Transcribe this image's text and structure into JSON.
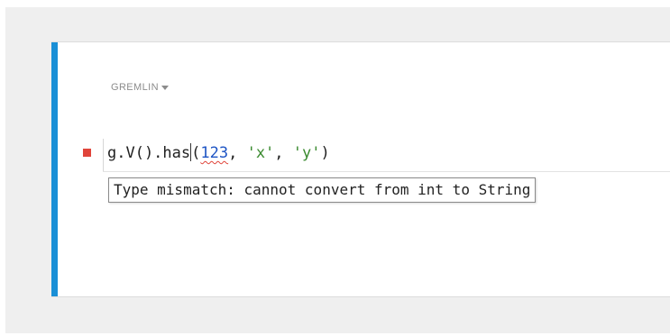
{
  "language_selector": {
    "label": "GREMLIN",
    "icon": "chevron-down-icon"
  },
  "editor": {
    "code_tokens": {
      "prefix": "g.V().has",
      "open_paren": "(",
      "number": "123",
      "sep1": ", ",
      "str1": "'x'",
      "sep2": ", ",
      "str2": "'y'",
      "close_paren": ")"
    },
    "error_marker": "error-marker-icon",
    "tooltip": "Type mismatch: cannot convert from int to String"
  },
  "colors": {
    "accent": "#1a8fd6",
    "error": "#e0443a",
    "number": "#1d54c4",
    "string": "#3a8a2f"
  }
}
